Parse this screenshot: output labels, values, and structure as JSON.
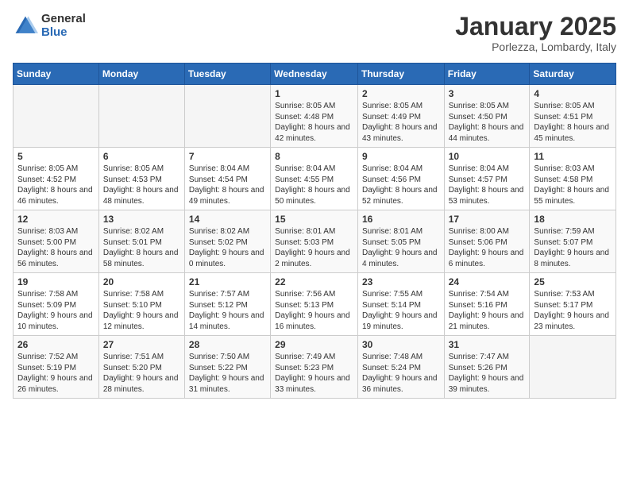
{
  "logo": {
    "general": "General",
    "blue": "Blue"
  },
  "header": {
    "month": "January 2025",
    "location": "Porlezza, Lombardy, Italy"
  },
  "weekdays": [
    "Sunday",
    "Monday",
    "Tuesday",
    "Wednesday",
    "Thursday",
    "Friday",
    "Saturday"
  ],
  "weeks": [
    [
      {
        "day": "",
        "info": ""
      },
      {
        "day": "",
        "info": ""
      },
      {
        "day": "",
        "info": ""
      },
      {
        "day": "1",
        "info": "Sunrise: 8:05 AM\nSunset: 4:48 PM\nDaylight: 8 hours and 42 minutes."
      },
      {
        "day": "2",
        "info": "Sunrise: 8:05 AM\nSunset: 4:49 PM\nDaylight: 8 hours and 43 minutes."
      },
      {
        "day": "3",
        "info": "Sunrise: 8:05 AM\nSunset: 4:50 PM\nDaylight: 8 hours and 44 minutes."
      },
      {
        "day": "4",
        "info": "Sunrise: 8:05 AM\nSunset: 4:51 PM\nDaylight: 8 hours and 45 minutes."
      }
    ],
    [
      {
        "day": "5",
        "info": "Sunrise: 8:05 AM\nSunset: 4:52 PM\nDaylight: 8 hours and 46 minutes."
      },
      {
        "day": "6",
        "info": "Sunrise: 8:05 AM\nSunset: 4:53 PM\nDaylight: 8 hours and 48 minutes."
      },
      {
        "day": "7",
        "info": "Sunrise: 8:04 AM\nSunset: 4:54 PM\nDaylight: 8 hours and 49 minutes."
      },
      {
        "day": "8",
        "info": "Sunrise: 8:04 AM\nSunset: 4:55 PM\nDaylight: 8 hours and 50 minutes."
      },
      {
        "day": "9",
        "info": "Sunrise: 8:04 AM\nSunset: 4:56 PM\nDaylight: 8 hours and 52 minutes."
      },
      {
        "day": "10",
        "info": "Sunrise: 8:04 AM\nSunset: 4:57 PM\nDaylight: 8 hours and 53 minutes."
      },
      {
        "day": "11",
        "info": "Sunrise: 8:03 AM\nSunset: 4:58 PM\nDaylight: 8 hours and 55 minutes."
      }
    ],
    [
      {
        "day": "12",
        "info": "Sunrise: 8:03 AM\nSunset: 5:00 PM\nDaylight: 8 hours and 56 minutes."
      },
      {
        "day": "13",
        "info": "Sunrise: 8:02 AM\nSunset: 5:01 PM\nDaylight: 8 hours and 58 minutes."
      },
      {
        "day": "14",
        "info": "Sunrise: 8:02 AM\nSunset: 5:02 PM\nDaylight: 9 hours and 0 minutes."
      },
      {
        "day": "15",
        "info": "Sunrise: 8:01 AM\nSunset: 5:03 PM\nDaylight: 9 hours and 2 minutes."
      },
      {
        "day": "16",
        "info": "Sunrise: 8:01 AM\nSunset: 5:05 PM\nDaylight: 9 hours and 4 minutes."
      },
      {
        "day": "17",
        "info": "Sunrise: 8:00 AM\nSunset: 5:06 PM\nDaylight: 9 hours and 6 minutes."
      },
      {
        "day": "18",
        "info": "Sunrise: 7:59 AM\nSunset: 5:07 PM\nDaylight: 9 hours and 8 minutes."
      }
    ],
    [
      {
        "day": "19",
        "info": "Sunrise: 7:58 AM\nSunset: 5:09 PM\nDaylight: 9 hours and 10 minutes."
      },
      {
        "day": "20",
        "info": "Sunrise: 7:58 AM\nSunset: 5:10 PM\nDaylight: 9 hours and 12 minutes."
      },
      {
        "day": "21",
        "info": "Sunrise: 7:57 AM\nSunset: 5:12 PM\nDaylight: 9 hours and 14 minutes."
      },
      {
        "day": "22",
        "info": "Sunrise: 7:56 AM\nSunset: 5:13 PM\nDaylight: 9 hours and 16 minutes."
      },
      {
        "day": "23",
        "info": "Sunrise: 7:55 AM\nSunset: 5:14 PM\nDaylight: 9 hours and 19 minutes."
      },
      {
        "day": "24",
        "info": "Sunrise: 7:54 AM\nSunset: 5:16 PM\nDaylight: 9 hours and 21 minutes."
      },
      {
        "day": "25",
        "info": "Sunrise: 7:53 AM\nSunset: 5:17 PM\nDaylight: 9 hours and 23 minutes."
      }
    ],
    [
      {
        "day": "26",
        "info": "Sunrise: 7:52 AM\nSunset: 5:19 PM\nDaylight: 9 hours and 26 minutes."
      },
      {
        "day": "27",
        "info": "Sunrise: 7:51 AM\nSunset: 5:20 PM\nDaylight: 9 hours and 28 minutes."
      },
      {
        "day": "28",
        "info": "Sunrise: 7:50 AM\nSunset: 5:22 PM\nDaylight: 9 hours and 31 minutes."
      },
      {
        "day": "29",
        "info": "Sunrise: 7:49 AM\nSunset: 5:23 PM\nDaylight: 9 hours and 33 minutes."
      },
      {
        "day": "30",
        "info": "Sunrise: 7:48 AM\nSunset: 5:24 PM\nDaylight: 9 hours and 36 minutes."
      },
      {
        "day": "31",
        "info": "Sunrise: 7:47 AM\nSunset: 5:26 PM\nDaylight: 9 hours and 39 minutes."
      },
      {
        "day": "",
        "info": ""
      }
    ]
  ]
}
